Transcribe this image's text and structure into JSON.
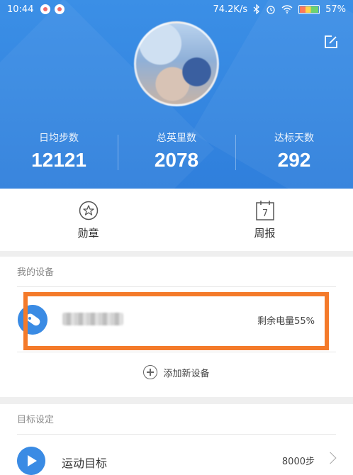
{
  "status_bar": {
    "time": "10:44",
    "network_speed": "74.2K/s",
    "battery_percent": "57%"
  },
  "stats": [
    {
      "label": "日均步数",
      "value": "12121"
    },
    {
      "label": "总英里数",
      "value": "2078"
    },
    {
      "label": "达标天数",
      "value": "292"
    }
  ],
  "quick": [
    {
      "label": "勋章",
      "icon": "medal-icon"
    },
    {
      "label": "周报",
      "icon": "calendar-icon",
      "day": "7"
    }
  ],
  "devices_section": {
    "title": "我的设备",
    "device_battery": "剩余电量55%",
    "add_device": "添加新设备"
  },
  "goals_section": {
    "title": "目标设定",
    "goal_label": "运动目标",
    "goal_value": "8000步"
  },
  "colors": {
    "primary": "#3a8be4",
    "highlight": "#f47a2a"
  }
}
